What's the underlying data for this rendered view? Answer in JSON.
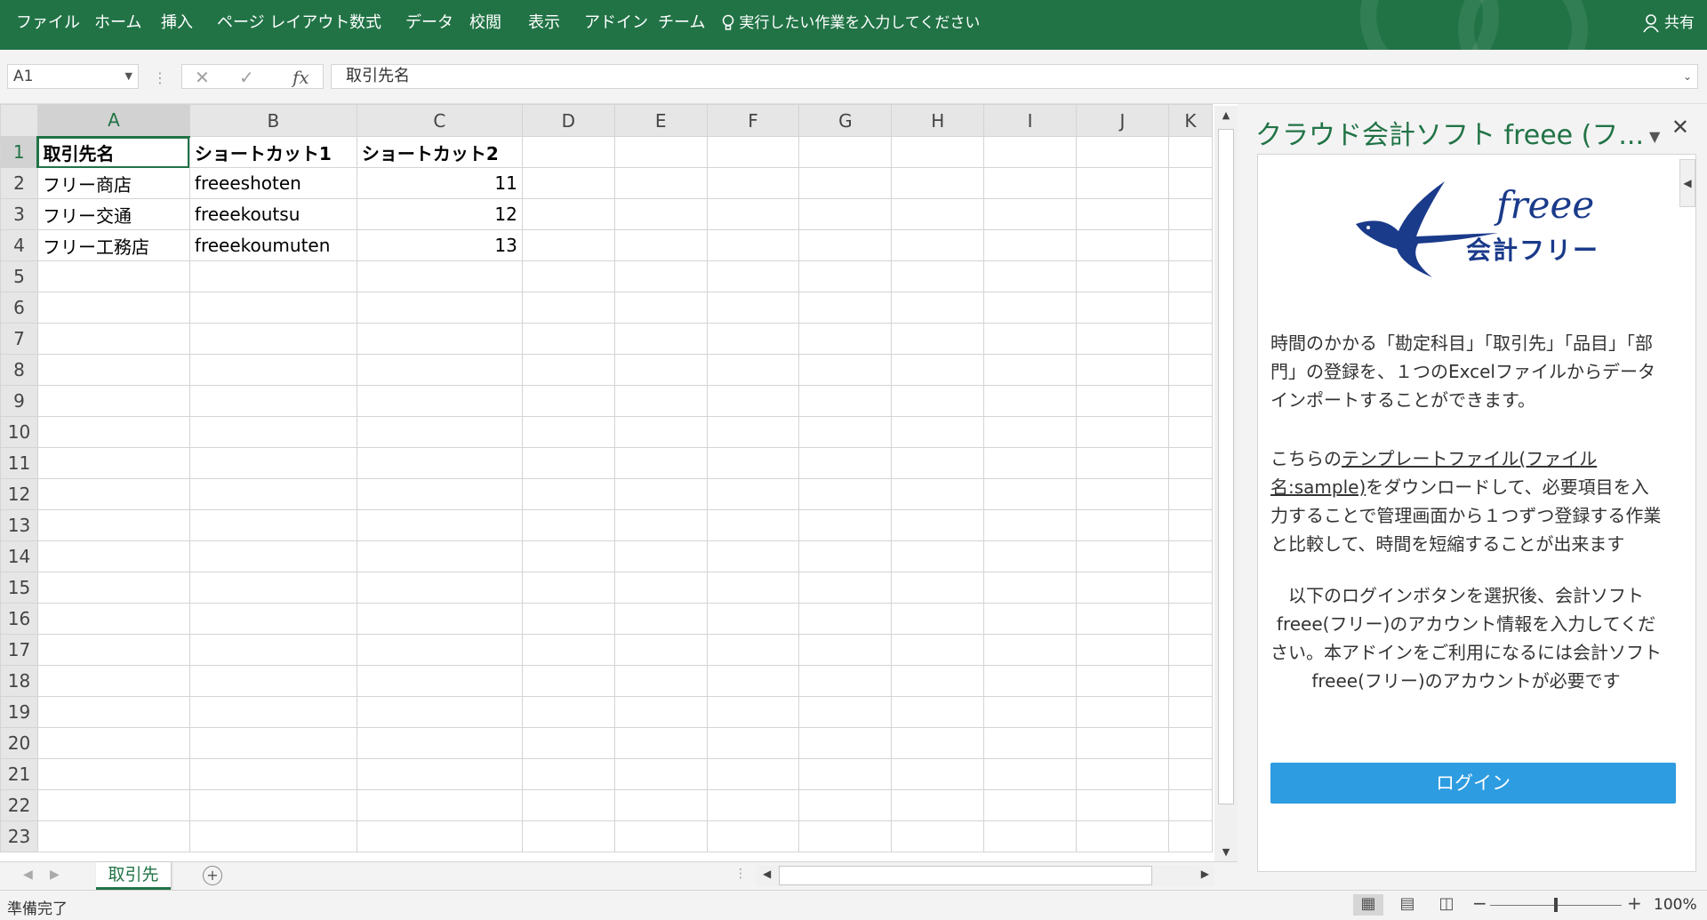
{
  "ribbon": {
    "tabs": [
      "ファイル",
      "ホーム",
      "挿入",
      "ページ レイアウト",
      "数式",
      "データ",
      "校閲",
      "表示",
      "アドイン",
      "チーム"
    ],
    "tell_me": "実行したい作業を入力してください",
    "share": "共有"
  },
  "formula_bar": {
    "name_box": "A1",
    "content": "取引先名"
  },
  "sheet": {
    "columns": [
      "A",
      "B",
      "C",
      "D",
      "E",
      "F",
      "G",
      "H",
      "I",
      "J",
      "K"
    ],
    "rows": [
      [
        "取引先名",
        "ショートカット1",
        "ショートカット2"
      ],
      [
        "フリー商店",
        "freeeshoten",
        "11"
      ],
      [
        "フリー交通",
        "freeekoutsu",
        "12"
      ],
      [
        "フリー工務店",
        "freeekoumuten",
        "13"
      ]
    ],
    "row_numbers": [
      "1",
      "2",
      "3",
      "4",
      "5",
      "6",
      "7",
      "8",
      "9",
      "10",
      "11",
      "12",
      "13",
      "14",
      "15",
      "16",
      "17",
      "18",
      "19",
      "20",
      "21",
      "22",
      "23"
    ],
    "tab_name": "取引先"
  },
  "status": {
    "ready": "準備完了",
    "zoom": "100%",
    "zoom_fraction": 0.5
  },
  "pane": {
    "title": "クラウド会計ソフト freee (フ...",
    "logo_word": "freee",
    "logo_text": "会計フリー",
    "para1": "時間のかかる「勘定科目」「取引先」「品目」「部門」の登録を、１つのExcelファイルからデータインポートすることができます。",
    "para2_before": "こちらの",
    "para2_link": "テンプレートファイル(ファイル名:sample)",
    "para2_after": "をダウンロードして、必要項目を入力することで管理画面から１つずつ登録する作業と比較して、時間を短縮することが出来ます",
    "para3": "以下のログインボタンを選択後、会計ソフトfreee(フリー)のアカウント情報を入力してください。本アドインをご利用になるには会計ソフトfreee(フリー)のアカウントが必要です",
    "login": "ログイン"
  },
  "colors": {
    "excel_green": "#217346",
    "login_blue": "#2d9ce0",
    "freee_navy": "#1a3a8a"
  }
}
